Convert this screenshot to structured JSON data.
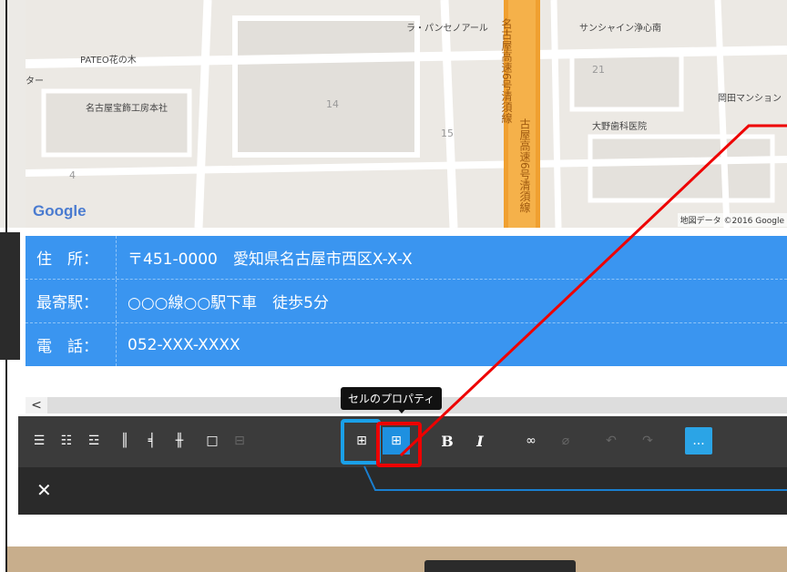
{
  "map": {
    "labels": [
      "PATEO花の木",
      "名古屋宝飾工房本社",
      "ラ・パンセノアール",
      "サンシャイン浄心南",
      "岡田マンション",
      "大野歯科医院",
      "名古屋高速6号清須線",
      "古屋高速6号清須線",
      "ター"
    ],
    "numbers": [
      "14",
      "15",
      "21",
      "4"
    ],
    "logo": "Google",
    "credit": "地図データ ©2016 Google"
  },
  "address_table": {
    "rows": [
      {
        "label": "住　所：",
        "value": "〒451-0000　愛知県名古屋市西区X-X-X"
      },
      {
        "label": "最寄駅：",
        "value": "○○○線○○駅下車　徒歩5分"
      },
      {
        "label": "電　話：",
        "value": "052-XXX-XXXX"
      }
    ]
  },
  "scroll": {
    "left_arrow": "<"
  },
  "tooltip": {
    "text": "セルのプロパティ"
  },
  "toolbar": {
    "bold": "B",
    "italic": "I",
    "more": "..."
  },
  "bottombar": {
    "close": "✕"
  },
  "colors": {
    "table_bg": "#3a95f0",
    "toolbar_bg": "#3b3b3b",
    "highlight_red": "#e00000",
    "highlight_blue": "#1aa0e8"
  }
}
